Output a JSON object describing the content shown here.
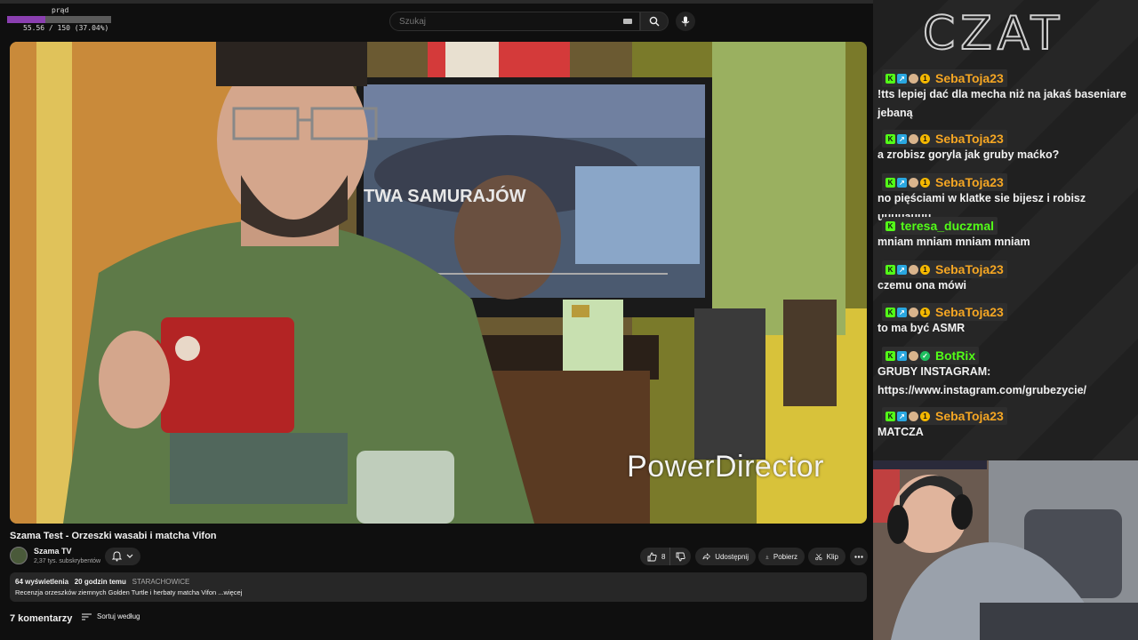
{
  "overlay": {
    "label": "prąd",
    "progress_text": "55.56 / 150 (37.04%)",
    "progress_fraction": 0.3704
  },
  "search": {
    "placeholder": "Szukaj"
  },
  "video": {
    "watermark": "PowerDirector",
    "title": "Szama Test - Orzeszki wasabi i matcha Vifon"
  },
  "channel": {
    "name": "Szama TV",
    "subscribers": "2,37 tys. subskrybentów"
  },
  "actions": {
    "likes": "8",
    "share": "Udostępnij",
    "download": "Pobierz",
    "clip": "Klip"
  },
  "description": {
    "views": "64 wyświetlenia",
    "time": "20 godzin temu",
    "hashtag": "STARACHOWICE",
    "text": "Recenzja orzeszków ziemnych Golden Turtle i herbaty matcha Vifon ...więcej"
  },
  "comments": {
    "count": "7 komentarzy",
    "sort_label": "Sortuj według"
  },
  "chat": {
    "logo": "CZAT",
    "messages": [
      {
        "user": "SebaToja23",
        "color": "#f5a623",
        "text": "!tts lepiej dać dla mecha niż na jakaś baseniare jebaną"
      },
      {
        "user": "SebaToja23",
        "color": "#f5a623",
        "text": "a zrobisz goryla jak gruby maćko?"
      },
      {
        "user": "SebaToja23",
        "color": "#f5a623",
        "text": "no pięściami w klatke sie bijesz i robisz uuuuauuu"
      },
      {
        "user": "teresa_duczmal",
        "color": "#53fc18",
        "text": "mniam mniam mniam mniam"
      },
      {
        "user": "SebaToja23",
        "color": "#f5a623",
        "text": "czemu ona mówi"
      },
      {
        "user": "SebaToja23",
        "color": "#f5a623",
        "text": "to ma być ASMR"
      },
      {
        "user": "BotRix",
        "color": "#53fc18",
        "text": "GRUBY INSTAGRAM: https://www.instagram.com/grubezycie/"
      },
      {
        "user": "SebaToja23",
        "color": "#f5a623",
        "text": "MATCZA"
      }
    ]
  }
}
